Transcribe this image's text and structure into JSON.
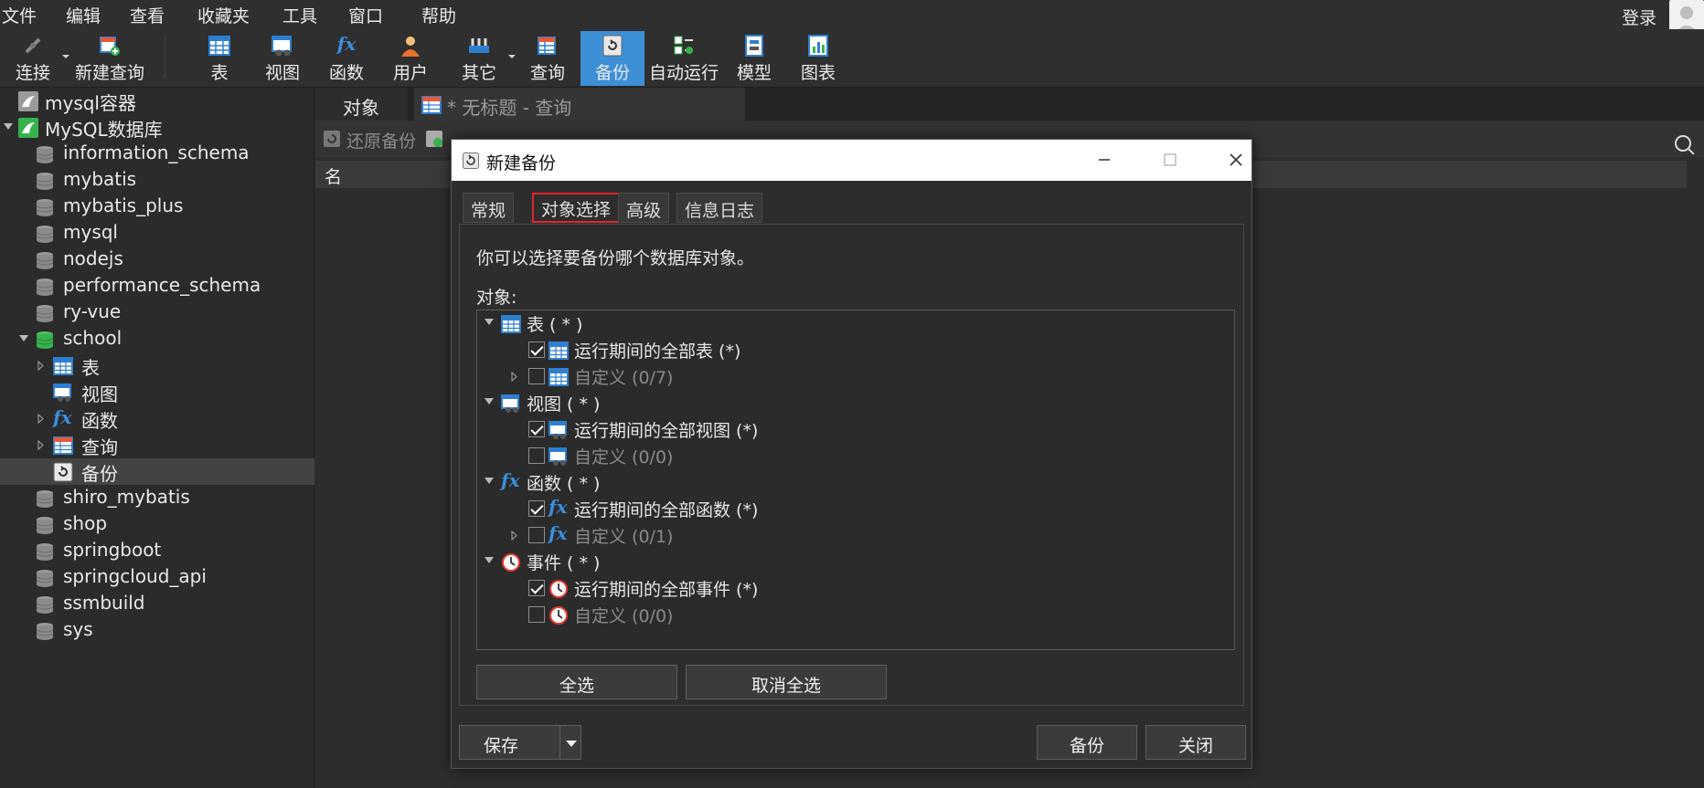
{
  "menu": [
    "文件",
    "编辑",
    "查看",
    "收藏夹",
    "工具",
    "窗口",
    "帮助"
  ],
  "login": "登录",
  "toolbar": {
    "connect": "连接",
    "new_query": "新建查询",
    "table": "表",
    "view": "视图",
    "function": "函数",
    "user": "用户",
    "other": "其它",
    "query": "查询",
    "backup": "备份",
    "autorun": "自动运行",
    "model": "模型",
    "chart": "图表"
  },
  "tree": {
    "items": [
      {
        "label": "mysql容器"
      },
      {
        "label": "MySQL数据库"
      },
      {
        "label": "information_schema"
      },
      {
        "label": "mybatis"
      },
      {
        "label": "mybatis_plus"
      },
      {
        "label": "mysql"
      },
      {
        "label": "nodejs"
      },
      {
        "label": "performance_schema"
      },
      {
        "label": "ry-vue"
      },
      {
        "label": "school"
      },
      {
        "label": "表"
      },
      {
        "label": "视图"
      },
      {
        "label": "函数"
      },
      {
        "label": "查询"
      },
      {
        "label": "备份"
      },
      {
        "label": "shiro_mybatis"
      },
      {
        "label": "shop"
      },
      {
        "label": "springboot"
      },
      {
        "label": "springcloud_api"
      },
      {
        "label": "ssmbuild"
      },
      {
        "label": "sys"
      }
    ]
  },
  "right": {
    "tab_objects": "对象",
    "tab_query": "* 无标题 - 查询",
    "restore_backup": "还原备份",
    "column_name": "名"
  },
  "dialog": {
    "title": "新建备份",
    "tabs": [
      "常规",
      "对象选择",
      "高级",
      "信息日志"
    ],
    "description": "你可以选择要备份哪个数据库对象。",
    "objects_label": "对象:",
    "objects": [
      {
        "label": "表 ( * )"
      },
      {
        "label": "运行期间的全部表 (*)"
      },
      {
        "label": "自定义 (0/7)"
      },
      {
        "label": "视图 ( * )"
      },
      {
        "label": "运行期间的全部视图 (*)"
      },
      {
        "label": "自定义 (0/0)"
      },
      {
        "label": "函数 ( * )"
      },
      {
        "label": "运行期间的全部函数 (*)"
      },
      {
        "label": "自定义 (0/1)"
      },
      {
        "label": "事件 ( * )"
      },
      {
        "label": "运行期间的全部事件 (*)"
      },
      {
        "label": "自定义 (0/0)"
      }
    ],
    "select_all": "全选",
    "deselect_all": "取消全选",
    "save": "保存",
    "backup": "备份",
    "close": "关闭"
  },
  "colors": {
    "accent": "#3d8fd6",
    "highlight": "#e0262a"
  }
}
